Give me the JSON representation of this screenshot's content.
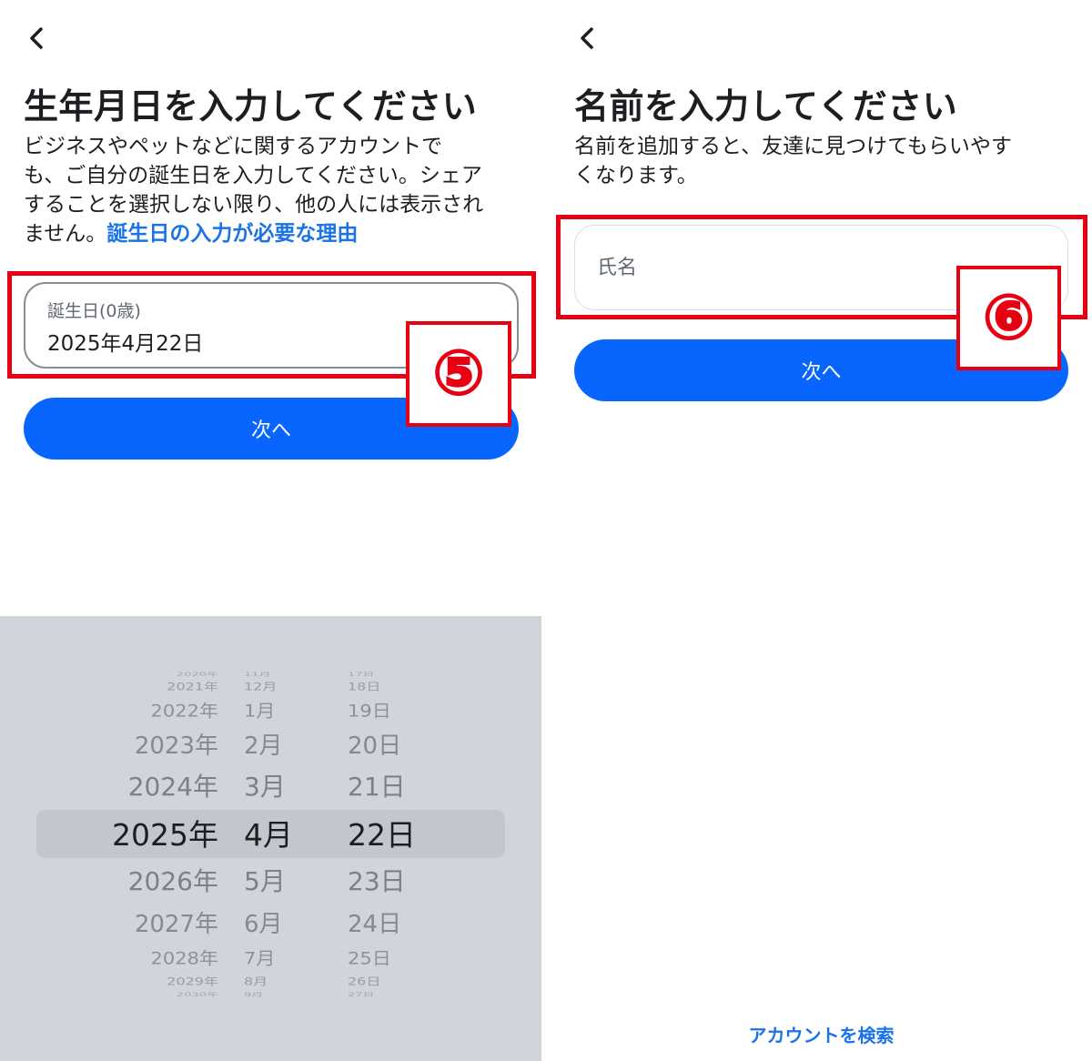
{
  "left": {
    "title": "生年月日を入力してください",
    "description_lines": [
      "ビジネスやペットなどに関するアカウントで",
      "も、ご自分の誕生日を入力してください。シェア",
      "することを選択しない限り、他の人には表示され",
      "ません。"
    ],
    "description_link": "誕生日の入力が必要な理由",
    "field_label": "誕生日(0歳)",
    "field_value": "2025年4月22日",
    "next_button": "次へ",
    "badge": "⑤"
  },
  "picker": {
    "years": [
      "2020年",
      "2021年",
      "2022年",
      "2023年",
      "2024年",
      "2025年",
      "2026年",
      "2027年",
      "2028年",
      "2029年",
      "2030年"
    ],
    "months": [
      "11月",
      "12月",
      "1月",
      "2月",
      "3月",
      "4月",
      "5月",
      "6月",
      "7月",
      "8月",
      "9月"
    ],
    "days": [
      "17日",
      "18日",
      "19日",
      "20日",
      "21日",
      "22日",
      "23日",
      "24日",
      "25日",
      "26日",
      "27日"
    ],
    "selected_index": 5
  },
  "right": {
    "title": "名前を入力してください",
    "description_lines": [
      "名前を追加すると、友達に見つけてもらいやす",
      "くなります。"
    ],
    "name_placeholder": "氏名",
    "next_button": "次へ",
    "badge": "⑥",
    "footer_link": "アカウントを検索"
  },
  "colors": {
    "accent": "#0866ff",
    "link": "#1a73e8",
    "highlight": "#e60012",
    "picker_bg": "#d1d5db"
  },
  "icons": {
    "back": "chevron-left-icon"
  }
}
